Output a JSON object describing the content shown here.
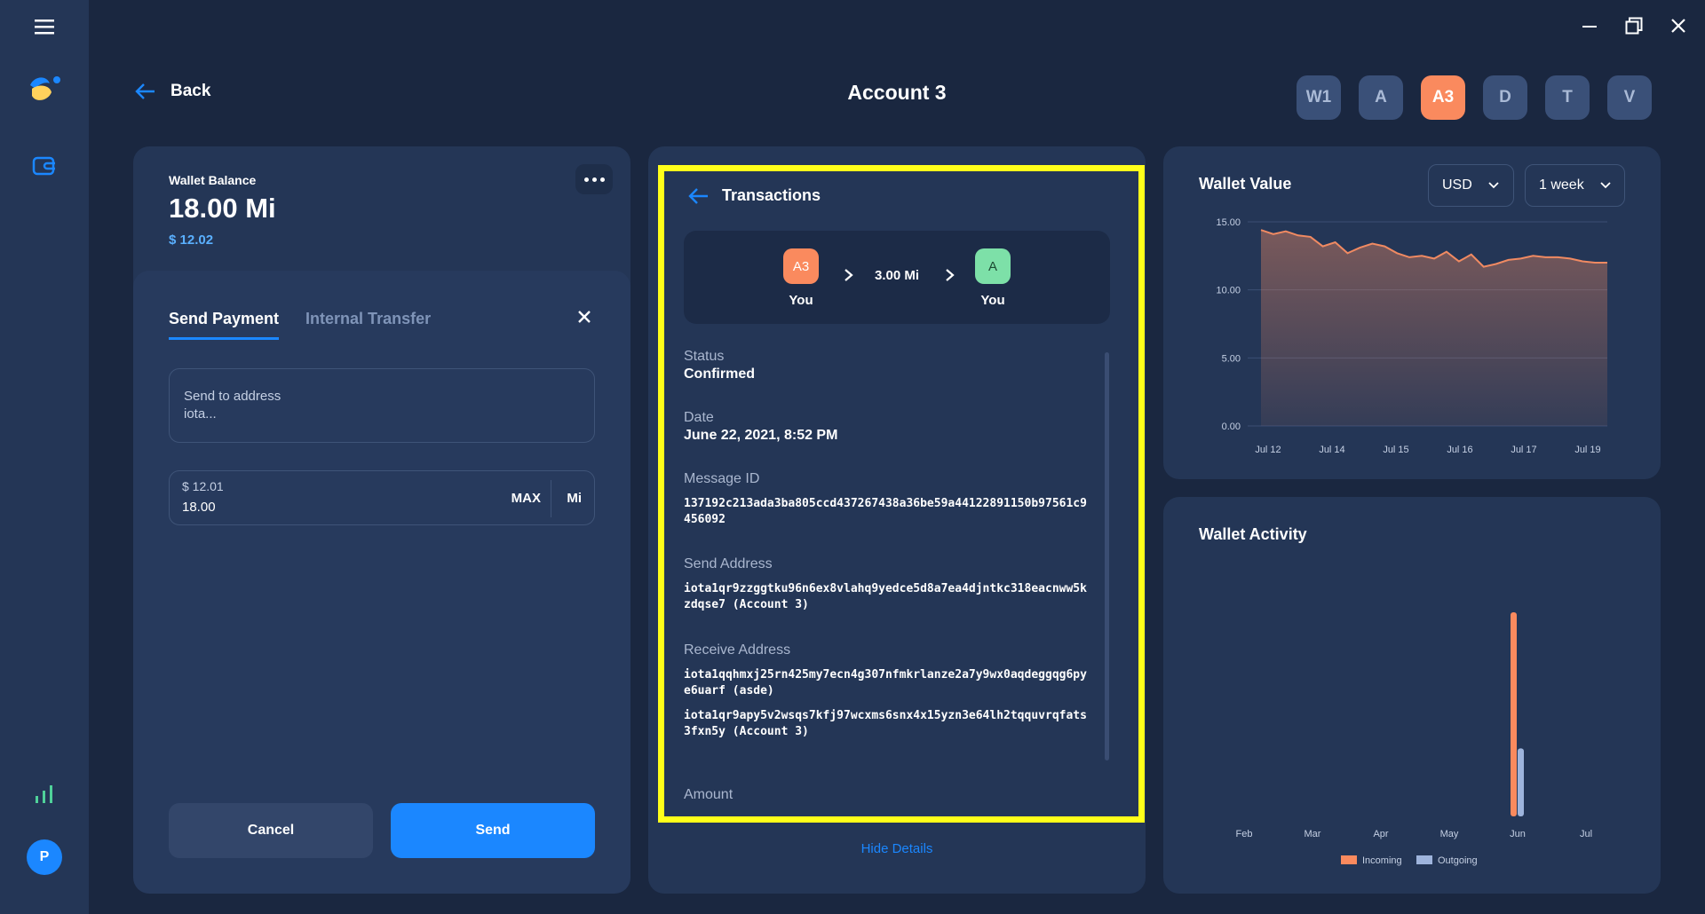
{
  "window": {
    "minimize_icon": "minimize-icon",
    "restore_icon": "restore-icon",
    "close_icon": "close-icon"
  },
  "sidebar": {
    "avatar_initial": "P"
  },
  "header": {
    "back_label": "Back",
    "title": "Account 3",
    "accounts": [
      {
        "label": "W1",
        "active": false
      },
      {
        "label": "A",
        "active": false
      },
      {
        "label": "A3",
        "active": true
      },
      {
        "label": "D",
        "active": false
      },
      {
        "label": "T",
        "active": false
      },
      {
        "label": "V",
        "active": false
      }
    ]
  },
  "balance": {
    "label": "Wallet Balance",
    "amount": "18.00 Mi",
    "fiat": "$ 12.02"
  },
  "send": {
    "tabs": [
      "Send Payment",
      "Internal Transfer"
    ],
    "address_label": "Send to address",
    "address_placeholder": "iota...",
    "amount_fiat": "$ 12.01",
    "amount_value": "18.00",
    "max_label": "MAX",
    "unit_label": "Mi",
    "cancel_label": "Cancel",
    "send_label": "Send"
  },
  "transaction": {
    "title": "Transactions",
    "from_chip": "A3",
    "from_label": "You",
    "amount": "3.00 Mi",
    "to_chip": "A",
    "to_label": "You",
    "status_label": "Status",
    "status_value": "Confirmed",
    "date_label": "Date",
    "date_value": "June 22, 2021, 8:52 PM",
    "message_id_label": "Message ID",
    "message_id_value": "137192c213ada3ba805ccd437267438a36be59a44122891150b97561c9456092",
    "send_address_label": "Send Address",
    "send_address_value": "iota1qr9zzggtku96n6ex8vlahq9yedce5d8a7ea4djntkc318eacnww5kzdqse7  (Account 3)",
    "receive_address_label": "Receive Address",
    "receive_address_1": "iota1qqhmxj25rn425my7ecn4g307nfmkrlanze2a7y9wx0aqdeggqg6pye6uarf  (asde)",
    "receive_address_2": "iota1qr9apy5v2wsqs7kfj97wcxms6snx4x15yzn3e64lh2tqquvrqfats3fxn5y  (Account 3)",
    "amount_label": "Amount",
    "hide_details": "Hide Details"
  },
  "wallet_value": {
    "title": "Wallet Value",
    "currency": "USD",
    "range": "1 week"
  },
  "wallet_activity": {
    "title": "Wallet Activity"
  },
  "chart_data": [
    {
      "type": "area",
      "title": "Wallet Value",
      "x_ticks": [
        "Jul 12",
        "Jul 14",
        "Jul 15",
        "Jul 16",
        "Jul 17",
        "Jul 19"
      ],
      "y_ticks": [
        "15.00",
        "10.00",
        "5.00",
        "0.00"
      ],
      "ylim": [
        0,
        15
      ],
      "series": [
        {
          "values": [
            14.4,
            14.1,
            14.3,
            14.0,
            13.9,
            13.2,
            13.5,
            12.7,
            13.1,
            13.4,
            13.2,
            12.7,
            12.4,
            12.5,
            12.3,
            12.8,
            12.1,
            12.6,
            11.7,
            11.9,
            12.2,
            12.3,
            12.5,
            12.4,
            12.4,
            12.3,
            12.1,
            12.0,
            12.0
          ]
        }
      ],
      "color": "#f08a62",
      "grid": true
    },
    {
      "type": "bar",
      "title": "Wallet Activity",
      "categories": [
        "Feb",
        "Mar",
        "Apr",
        "May",
        "Jun",
        "Jul"
      ],
      "series": [
        {
          "name": "Incoming",
          "values": [
            0,
            0,
            0,
            0,
            18,
            0
          ],
          "color": "#fa8a5e"
        },
        {
          "name": "Outgoing",
          "values": [
            0,
            0,
            0,
            0,
            6,
            0
          ],
          "color": "#9eb4dc"
        }
      ],
      "ylim": [
        0,
        18
      ],
      "legend": "bottom"
    }
  ]
}
